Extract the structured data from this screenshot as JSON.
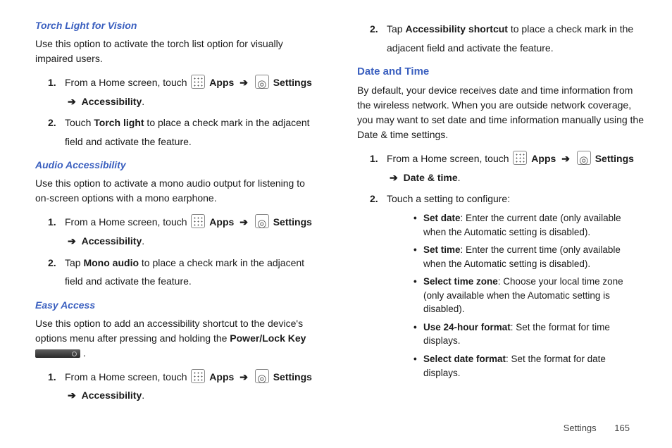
{
  "left": {
    "torch": {
      "heading": "Torch Light for Vision",
      "intro": "Use this option to activate the torch list option for visually impaired users.",
      "step1_pre": "From a Home screen, touch ",
      "apps": "Apps",
      "settings": "Settings",
      "accessibility": "Accessibility",
      "step2_a": "Touch ",
      "step2_bold": "Torch light",
      "step2_b": " to place a check mark in the adjacent field and activate the feature."
    },
    "audio": {
      "heading": "Audio Accessibility",
      "intro": "Use this option to activate a mono audio output for listening to on-screen options with a mono earphone.",
      "step1_pre": "From a Home screen, touch ",
      "apps": "Apps",
      "settings": "Settings",
      "accessibility": "Accessibility",
      "step2_a": "Tap ",
      "step2_bold": "Mono audio",
      "step2_b": " to place a check mark in the adjacent field and activate the feature."
    },
    "easy": {
      "heading": "Easy Access",
      "intro_a": "Use this option to add an accessibility shortcut to the device's options menu after pressing and holding the ",
      "intro_bold": "Power/Lock Key",
      "step1_pre": "From a Home screen, touch ",
      "apps": "Apps",
      "settings": "Settings",
      "accessibility": "Accessibility"
    }
  },
  "right": {
    "easy_step2_a": "Tap ",
    "easy_step2_bold": "Accessibility shortcut",
    "easy_step2_b": " to place a check mark in the adjacent field and activate the feature.",
    "dt": {
      "heading": "Date and Time",
      "intro": "By default, your device receives date and time information from the wireless network. When you are outside network coverage, you may want to set date and time information manually using the Date & time settings.",
      "step1_pre": "From a Home screen, touch ",
      "apps": "Apps",
      "settings": "Settings",
      "datetime": "Date & time",
      "step2": "Touch a setting to configure:",
      "bullets": [
        {
          "bold": "Set date",
          "rest": ": Enter the current date (only available when the Automatic setting is disabled)."
        },
        {
          "bold": "Set time",
          "rest": ": Enter the current time (only available when the Automatic setting is disabled)."
        },
        {
          "bold": "Select time zone",
          "rest": ": Choose your local time zone (only available when the Automatic setting is disabled)."
        },
        {
          "bold": "Use 24-hour format",
          "rest": ": Set the format for time displays."
        },
        {
          "bold": "Select date format",
          "rest": ": Set the format for date displays."
        }
      ]
    }
  },
  "arrow": "➔",
  "footer": {
    "section": "Settings",
    "page": "165"
  }
}
